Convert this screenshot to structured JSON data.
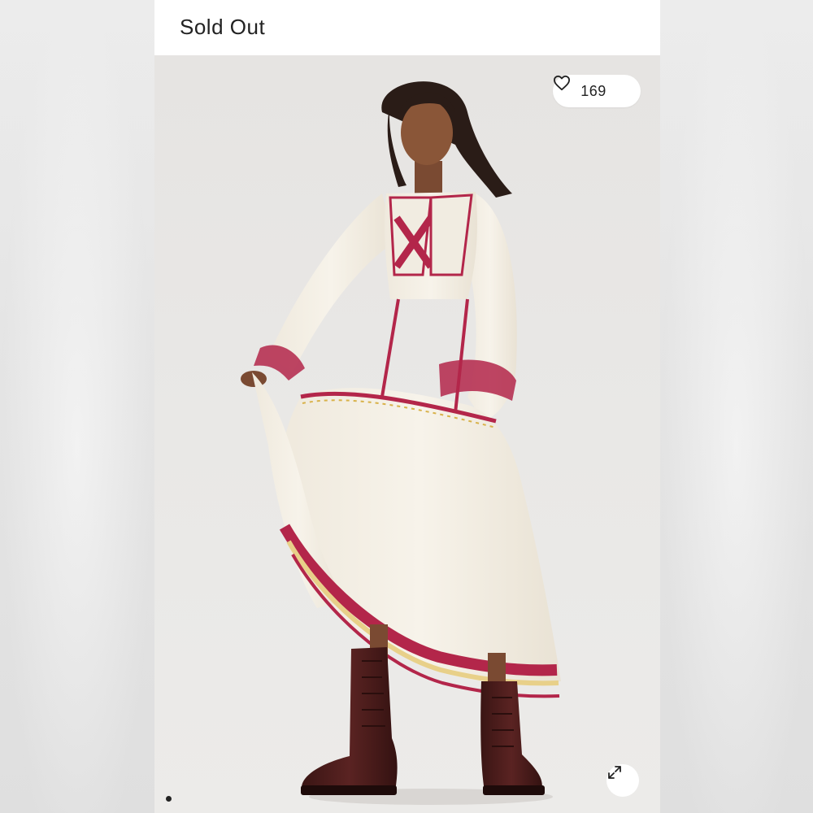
{
  "listing": {
    "status": "Sold Out",
    "likes": "169"
  },
  "icons": {
    "like": "heart-icon",
    "expand": "expand-arrows-icon"
  },
  "carousel": {
    "current": 1
  },
  "colors": {
    "background": "#e8e6e4",
    "dress": "#f4efe4",
    "embroidery": "#b3264a",
    "boots": "#4a1d1c"
  }
}
